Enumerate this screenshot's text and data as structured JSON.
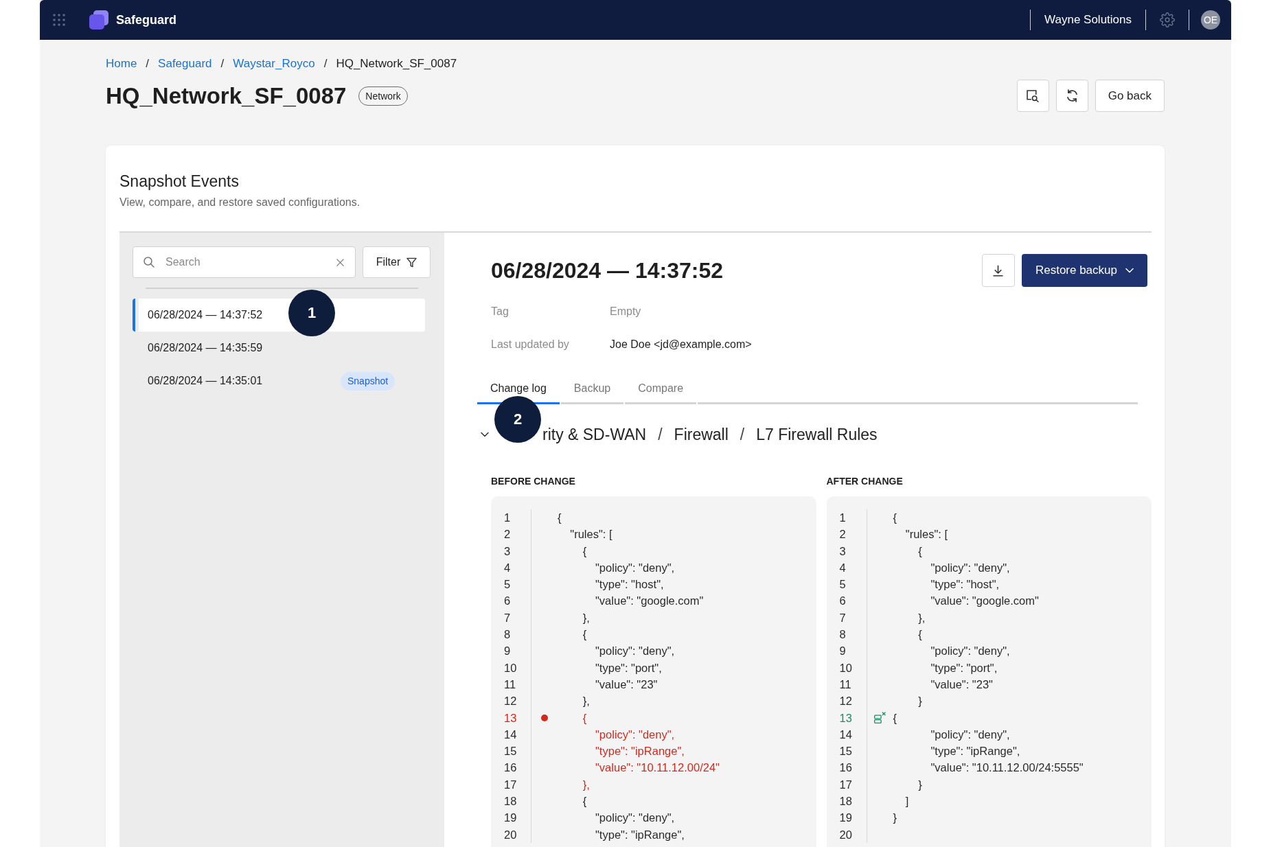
{
  "topbar": {
    "app_name": "Safeguard",
    "organization": "Wayne Solutions",
    "avatar": "OE"
  },
  "breadcrumbs": {
    "separator": "/",
    "items": [
      {
        "label": "Home",
        "current": false
      },
      {
        "label": "Safeguard",
        "current": false
      },
      {
        "label": "Waystar_Royco",
        "current": false
      },
      {
        "label": "HQ_Network_SF_0087",
        "current": true
      }
    ]
  },
  "page": {
    "title": "HQ_Network_SF_0087",
    "badge": "Network",
    "actions": [
      {
        "kind": "inspect"
      },
      {
        "kind": "refresh"
      },
      {
        "kind": "text",
        "label": "Go back"
      }
    ]
  },
  "card": {
    "title": "Snapshot Events",
    "subtitle": "View, compare, and restore saved configurations."
  },
  "sidebar": {
    "search": {
      "placeholder": "Search"
    },
    "filter": "Filter",
    "items": [
      {
        "label": "06/28/2024 — 14:37:52",
        "selected": true
      },
      {
        "label": "06/28/2024 — 14:35:59",
        "selected": false
      },
      {
        "label": "06/28/2024 — 14:35:01",
        "selected": false,
        "tag": "Snapshot"
      }
    ]
  },
  "detail": {
    "title": "06/28/2024 — 14:37:52",
    "restore_label": "Restore backup",
    "fields": [
      {
        "label": "Tag",
        "value": "Empty",
        "muted": true
      },
      {
        "label": "Last updated by",
        "value": "Joe Doe <jd@example.com>",
        "muted": false
      }
    ],
    "tabs": [
      {
        "label": "Change log",
        "selected": true
      },
      {
        "label": "Backup",
        "selected": false
      },
      {
        "label": "Compare",
        "selected": false
      }
    ],
    "section": {
      "expanded": true,
      "separator": "/",
      "path": [
        "rity & SD-WAN",
        "Firewall",
        "L7 Firewall Rules"
      ]
    },
    "panels": [
      {
        "kind": "removed",
        "heading": "BEFORE CHANGE",
        "blocks": [
          {
            "changed": false,
            "lines": [
              {
                "number": "1",
                "text": "{",
                "flagged": false
              },
              {
                "number": "2",
                "text": "    \"rules\": [",
                "flagged": false
              },
              {
                "number": "3",
                "text": "        {",
                "flagged": false
              },
              {
                "number": "4",
                "text": "            \"policy\": \"deny\",",
                "flagged": false
              },
              {
                "number": "5",
                "text": "            \"type\": \"host\",",
                "flagged": false
              },
              {
                "number": "6",
                "text": "            \"value\": \"google.com\"",
                "flagged": false
              },
              {
                "number": "7",
                "text": "        },",
                "flagged": false
              },
              {
                "number": "8",
                "text": "        {",
                "flagged": false
              },
              {
                "number": "9",
                "text": "            \"policy\": \"deny\",",
                "flagged": false
              },
              {
                "number": "10",
                "text": "            \"type\": \"port\",",
                "flagged": false
              },
              {
                "number": "11",
                "text": "            \"value\": \"23\"",
                "flagged": false
              },
              {
                "number": "12",
                "text": "        },",
                "flagged": false
              }
            ]
          },
          {
            "changed": true,
            "lines": [
              {
                "number": "13",
                "text": "        {",
                "flagged": true
              },
              {
                "number": "14",
                "text": "            \"policy\": \"deny\",",
                "flagged": false
              },
              {
                "number": "15",
                "text": "            \"type\": \"ipRange\",",
                "flagged": false
              },
              {
                "number": "16",
                "text": "            \"value\": \"10.11.12.00/24\"",
                "flagged": false
              },
              {
                "number": "17",
                "text": "        },",
                "flagged": false
              }
            ]
          },
          {
            "changed": false,
            "lines": [
              {
                "number": "18",
                "text": "        {",
                "flagged": false
              },
              {
                "number": "19",
                "text": "            \"policy\": \"deny\",",
                "flagged": false
              },
              {
                "number": "20",
                "text": "            \"type\": \"ipRange\",",
                "flagged": false
              }
            ]
          }
        ]
      },
      {
        "kind": "added",
        "heading": "AFTER CHANGE",
        "blocks": [
          {
            "changed": false,
            "lines": [
              {
                "number": "1",
                "text": "{",
                "flagged": false
              },
              {
                "number": "2",
                "text": "    \"rules\": [",
                "flagged": false
              },
              {
                "number": "3",
                "text": "        {",
                "flagged": false
              },
              {
                "number": "4",
                "text": "            \"policy\": \"deny\",",
                "flagged": false
              },
              {
                "number": "5",
                "text": "            \"type\": \"host\",",
                "flagged": false
              },
              {
                "number": "6",
                "text": "            \"value\": \"google.com\"",
                "flagged": false
              },
              {
                "number": "7",
                "text": "        },",
                "flagged": false
              },
              {
                "number": "8",
                "text": "        {",
                "flagged": false
              },
              {
                "number": "9",
                "text": "            \"policy\": \"deny\",",
                "flagged": false
              },
              {
                "number": "10",
                "text": "            \"type\": \"port\",",
                "flagged": false
              },
              {
                "number": "11",
                "text": "            \"value\": \"23\"",
                "flagged": false
              },
              {
                "number": "12",
                "text": "        }",
                "flagged": false
              },
              {
                "number": "13",
                "text": "{",
                "flagged": true
              },
              {
                "number": "14",
                "text": "            \"policy\": \"deny\",",
                "flagged": false
              },
              {
                "number": "15",
                "text": "            \"type\": \"ipRange\",",
                "flagged": false
              },
              {
                "number": "16",
                "text": "            \"value\": \"10.11.12.00/24:5555\"",
                "flagged": false
              },
              {
                "number": "17",
                "text": "        }",
                "flagged": false
              },
              {
                "number": "18",
                "text": "    ]",
                "flagged": false
              },
              {
                "number": "19",
                "text": "}",
                "flagged": false
              },
              {
                "number": "20",
                "flagged": false
              }
            ]
          }
        ]
      }
    ]
  },
  "annotations": [
    {
      "label": "1"
    },
    {
      "label": "2"
    }
  ]
}
